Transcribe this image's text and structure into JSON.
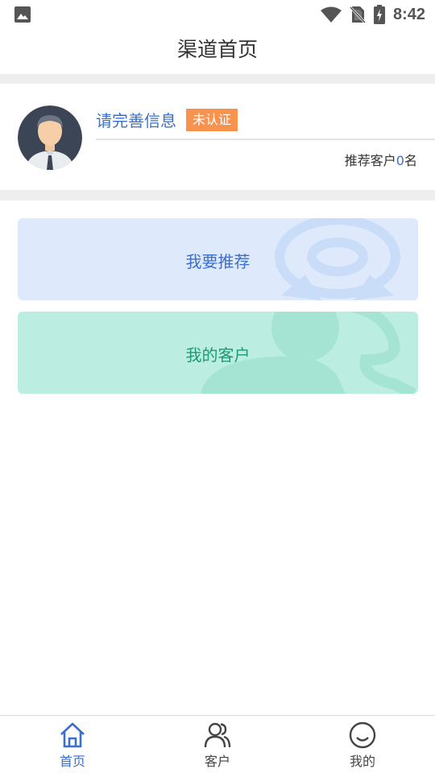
{
  "status_bar": {
    "time": "8:42"
  },
  "header": {
    "title": "渠道首页"
  },
  "profile": {
    "name_prompt": "请完善信息",
    "badge": "未认证",
    "recommend_prefix": "推荐客户",
    "recommend_count": "0",
    "recommend_suffix": "名"
  },
  "cards": {
    "recommend": "我要推荐",
    "customers": "我的客户"
  },
  "tabbar": {
    "home": "首页",
    "customers": "客户",
    "mine": "我的"
  },
  "colors": {
    "accent": "#3a6fcf",
    "badge": "#f7934f",
    "card_blue": "#dee9fb",
    "card_green": "#bbede0",
    "green_text": "#1f9a72"
  },
  "icons": [
    "gallery-icon",
    "wifi-icon",
    "no-sim-icon",
    "battery-charging-icon",
    "home-icon",
    "customers-icon",
    "smile-icon",
    "avatar"
  ]
}
